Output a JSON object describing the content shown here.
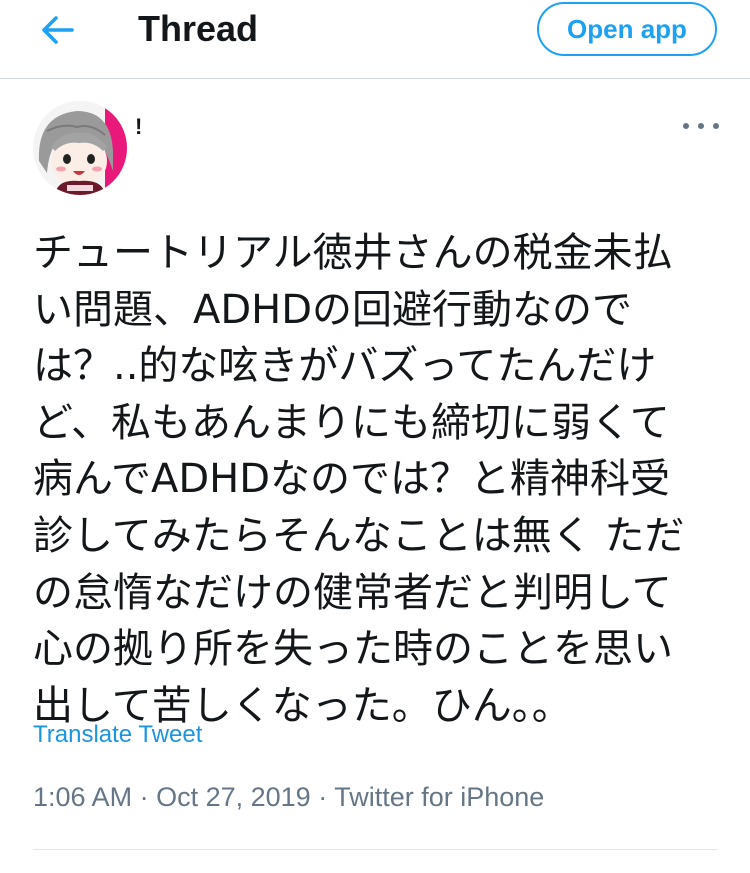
{
  "header": {
    "back_icon": "arrow-left-icon",
    "title": "Thread",
    "open_app_label": "Open app",
    "accent_color": "#1da1f2"
  },
  "tweet": {
    "author_name": "!",
    "avatar_icon": "user-avatar-illustration",
    "more_icon": "more-horizontal-icon",
    "text": "チュートリアル徳井さんの税金未払\nい問題、ADHDの回避行動なので\nは？..的な呟きがバズってたんだけ\nど、私もあんまりにも締切に弱くて\n病んでADHDなのでは？と精神科受\n診してみたらそんなことは無く ただ\nの怠惰なだけの健常者だと判明して\n心の拠り所を失った時のことを思い\n出して苦しくなった。ひん。。",
    "translate_label": "Translate Tweet",
    "meta": {
      "time": "1:06 AM",
      "date": "Oct 27, 2019",
      "separator": "·",
      "source": "Twitter for iPhone"
    }
  }
}
